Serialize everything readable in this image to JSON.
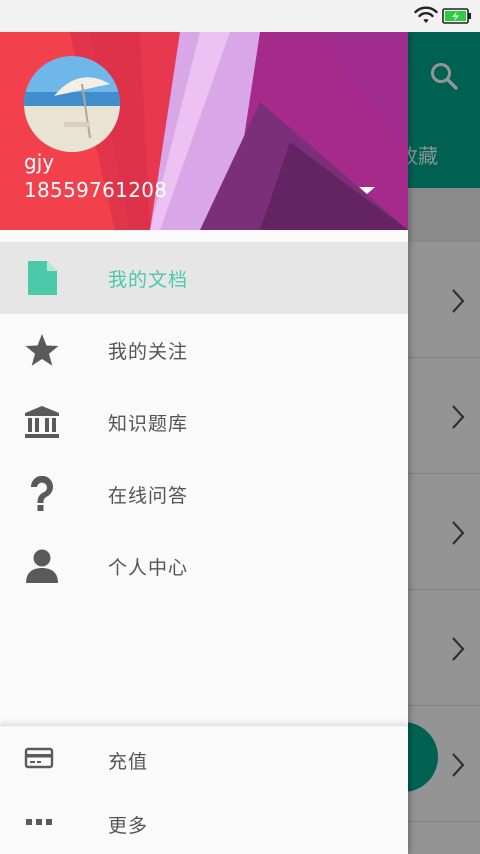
{
  "status_bar": {
    "icons": [
      "wifi-icon",
      "battery-charging-icon"
    ],
    "battery_color": "#2ecc40"
  },
  "background_app": {
    "toolbar_color": "#00a88f",
    "tab_label": "收藏",
    "icons": [
      "search-icon",
      "chevron-right-icon"
    ]
  },
  "drawer": {
    "header": {
      "user_name": "gjy",
      "phone": "18559761208",
      "avatar": "beach-umbrella-avatar",
      "colors": [
        "#e8384f",
        "#a52a8c",
        "#d9a7e8"
      ]
    },
    "menu": [
      {
        "label": "我的文档",
        "icon": "document-icon",
        "active": true
      },
      {
        "label": "我的关注",
        "icon": "star-icon",
        "active": false
      },
      {
        "label": "知识题库",
        "icon": "bank-icon",
        "active": false
      },
      {
        "label": "在线问答",
        "icon": "question-icon",
        "active": false
      },
      {
        "label": "个人中心",
        "icon": "person-icon",
        "active": false
      }
    ],
    "footer": [
      {
        "label": "充值",
        "icon": "credit-card-icon"
      },
      {
        "label": "更多",
        "icon": "more-dots-icon"
      }
    ],
    "accent_color": "#4cc9a9"
  }
}
